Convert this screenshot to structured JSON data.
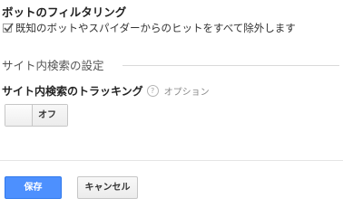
{
  "bot_filtering": {
    "title": "ボットのフィルタリング",
    "checkbox_label": "既知のボットやスパイダーからのヒットをすべて除外します",
    "checked": true
  },
  "site_search": {
    "section_title": "サイト内検索の設定",
    "tracking_label": "サイト内検索のトラッキング",
    "help_icon_text": "?",
    "optional_label": "オプション",
    "toggle_label": "オフ",
    "toggle_on": false
  },
  "actions": {
    "save_label": "保存",
    "cancel_label": "キャンセル"
  },
  "colors": {
    "primary_button": "#4d90fe",
    "text": "#333333"
  }
}
